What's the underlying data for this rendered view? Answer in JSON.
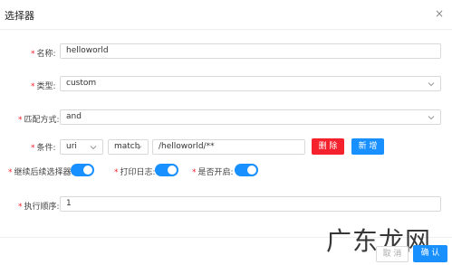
{
  "dialog": {
    "title": "选择器",
    "close_glyph": "×"
  },
  "form": {
    "required_mark": "*",
    "name": {
      "label": "名称:",
      "value": "helloworld"
    },
    "type": {
      "label": "类型:",
      "value": "custom"
    },
    "match_mode": {
      "label": "匹配方式:",
      "value": "and"
    },
    "condition": {
      "label": "条件:",
      "param_type": "uri",
      "operator": "match",
      "value": "/helloworld/**",
      "delete_label": "删 除",
      "add_label": "新 增"
    },
    "continue_label": "继续后续选择器:",
    "log_label": "打印日志:",
    "enabled_label": "是否开启:",
    "order": {
      "label": "执行顺序:",
      "value": "1"
    }
  },
  "switches": {
    "continue": true,
    "log": true,
    "enabled": true
  },
  "footer": {
    "cancel_label": "取 消",
    "confirm_label": "确 认"
  },
  "watermark": "广东龙网",
  "colors": {
    "primary": "#1890ff",
    "danger": "#f5222d"
  },
  "icons": {
    "close": "close-icon",
    "dropdown": "chevron-down-icon"
  }
}
